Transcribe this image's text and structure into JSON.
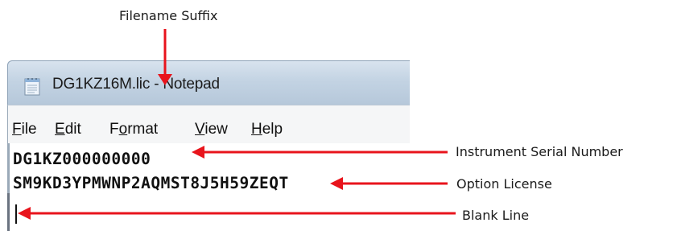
{
  "annotations": {
    "filename_suffix": "Filename Suffix",
    "serial_number": "Instrument Serial Number",
    "option_license": "Option  License",
    "blank_line": "Blank  Line"
  },
  "window": {
    "title": "DG1KZ16M.lic - Notepad",
    "icon": "notepad-icon"
  },
  "menu": {
    "file": {
      "prefix": "",
      "underline": "F",
      "rest": "ile"
    },
    "edit": {
      "prefix": "",
      "underline": "E",
      "rest": "dit"
    },
    "format": {
      "prefix": "F",
      "underline": "o",
      "rest": "rmat"
    },
    "view": {
      "prefix": "",
      "underline": "V",
      "rest": "iew"
    },
    "help": {
      "prefix": "",
      "underline": "H",
      "rest": "elp"
    }
  },
  "document": {
    "line1": "DG1KZ000000000",
    "line2": "SM9KD3YPMWNP2AQMST8J5H59ZEQT",
    "line3": ""
  },
  "colors": {
    "arrow": "#e8141c",
    "text": "#1a1a1a"
  }
}
